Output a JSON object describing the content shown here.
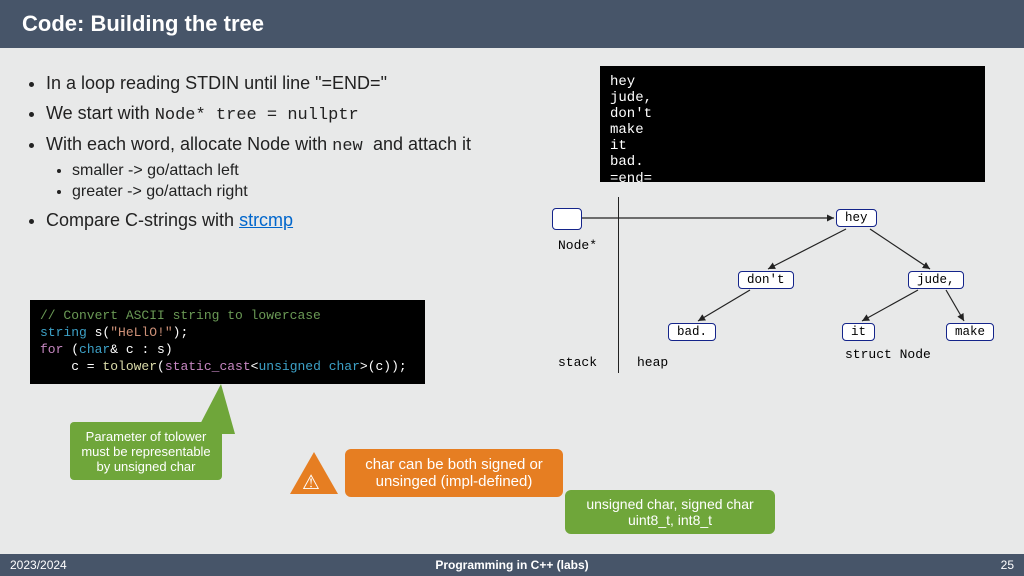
{
  "header": {
    "title": "Code: Building the tree"
  },
  "bullets": {
    "b1": "In a loop reading STDIN until line \"=END=\"",
    "b2_pre": "We start with ",
    "b2_code": "Node* tree = nullptr",
    "b3_pre": "With each word, allocate Node with ",
    "b3_code": "new ",
    "b3_post": " and attach it",
    "b3a": "smaller -> go/attach left",
    "b3b": "greater -> go/attach right",
    "b4_pre": "Compare C-strings with ",
    "b4_link": "strcmp"
  },
  "terminal": "hey\njude,\ndon't\nmake\nit\nbad.\n=end=",
  "tree": {
    "nodeptr": "Node*",
    "stack": "stack",
    "heap": "heap",
    "struct": "struct Node",
    "n_hey": "hey",
    "n_dont": "don't",
    "n_jude": "jude,",
    "n_bad": "bad.",
    "n_it": "it",
    "n_make": "make"
  },
  "code": {
    "comment": "// Convert ASCII string to lowercase",
    "l2a": "string",
    "l2b": " s(",
    "l2c": "\"HeLlO!\"",
    "l2d": ");",
    "l3a": "for",
    "l3b": " (",
    "l3c": "char",
    "l3d": "& c : s)",
    "l4a": "    c = ",
    "l4b": "tolower",
    "l4c": "(",
    "l4d": "static_cast",
    "l4e": "<",
    "l4f": "unsigned char",
    "l4g": ">(c));"
  },
  "callouts": {
    "green1": "Parameter of tolower must be representable by unsigned char",
    "orange": "char can be both signed or unsinged (impl-defined)",
    "green2": "unsigned char, signed char uint8_t, int8_t"
  },
  "footer": {
    "left": "2023/2024",
    "center": "Programming in C++ (labs)",
    "page": "25"
  }
}
